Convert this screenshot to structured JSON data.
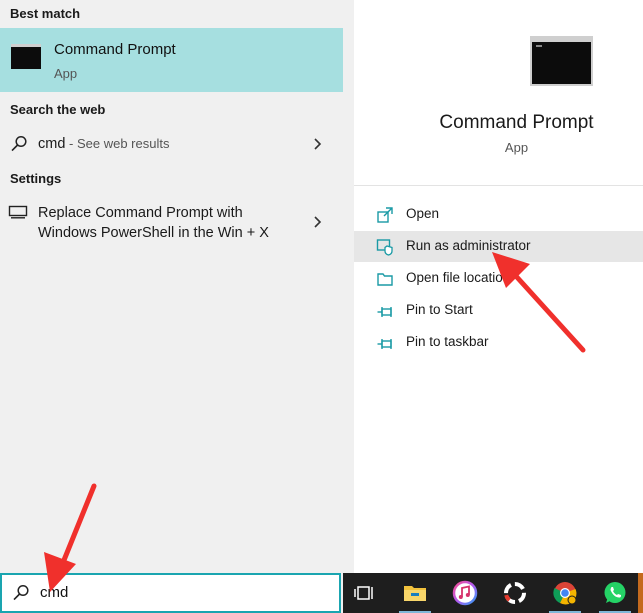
{
  "left": {
    "best_match_heading": "Best match",
    "best_match": {
      "title": "Command Prompt",
      "subtitle": "App"
    },
    "web_heading": "Search the web",
    "web_result": {
      "query": "cmd",
      "suffix": " - See web results"
    },
    "settings_heading": "Settings",
    "settings_result": {
      "line1": "Replace Command Prompt with",
      "line2": "Windows PowerShell in the Win + X"
    }
  },
  "right": {
    "app_title": "Command Prompt",
    "app_subtitle": "App",
    "actions": [
      {
        "label": "Open",
        "icon": "open-icon"
      },
      {
        "label": "Run as administrator",
        "icon": "shield-icon"
      },
      {
        "label": "Open file location",
        "icon": "folder-icon"
      },
      {
        "label": "Pin to Start",
        "icon": "pin-icon"
      },
      {
        "label": "Pin to taskbar",
        "icon": "pin-icon"
      }
    ]
  },
  "search": {
    "value": "cmd"
  },
  "taskbar": {
    "items": [
      "task-view-icon",
      "file-explorer-icon",
      "itunes-icon",
      "app-icon",
      "chrome-icon",
      "whatsapp-icon"
    ]
  },
  "colors": {
    "accent": "#1aa5b0",
    "highlight": "#a6dfe0",
    "icon_teal": "#1a9aa5",
    "arrow_red": "#f0302c"
  }
}
